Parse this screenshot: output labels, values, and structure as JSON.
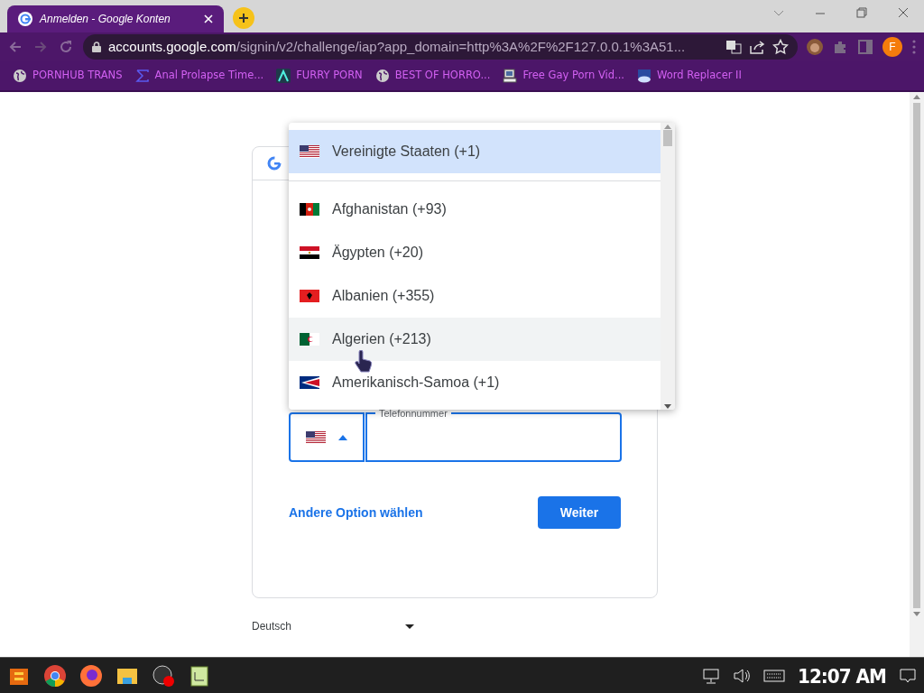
{
  "browser": {
    "tab": {
      "title": "Anmelden - Google Konten",
      "selected": true
    },
    "url": {
      "host": "accounts.google.com",
      "path": "/signin/v2/challenge/iap?app_domain=http%3A%2F%2F127.0.0.1%3A51..."
    },
    "profile_initial": "F",
    "bookmarks": [
      {
        "label": "PORNHUB TRANS",
        "kind": "globe"
      },
      {
        "label": "Anal Prolapse Time...",
        "kind": "sigma"
      },
      {
        "label": "FURRY PORN",
        "kind": "lambda"
      },
      {
        "label": "BEST OF HORRO...",
        "kind": "globe"
      },
      {
        "label": "Free Gay Porn Vid...",
        "kind": "computer"
      },
      {
        "label": "Word Replacer II",
        "kind": "cloud"
      }
    ]
  },
  "card": {
    "phone_label": "Telefonnummer",
    "other_option_link": "Andere Option wählen",
    "next_button": "Weiter"
  },
  "country_dropdown": {
    "items": [
      {
        "label": "Vereinigte Staaten (+1)",
        "kind": "us",
        "selected": true,
        "hovered": false
      },
      {
        "label": "Afghanistan (+93)",
        "kind": "af",
        "selected": false,
        "hovered": false
      },
      {
        "label": "Ägypten (+20)",
        "kind": "eg",
        "selected": false,
        "hovered": false
      },
      {
        "label": "Albanien (+355)",
        "kind": "al",
        "selected": false,
        "hovered": false
      },
      {
        "label": "Algerien (+213)",
        "kind": "dz",
        "selected": false,
        "hovered": true
      },
      {
        "label": "Amerikanisch-Samoa (+1)",
        "kind": "as",
        "selected": false,
        "hovered": false
      }
    ]
  },
  "language": "Deutsch",
  "taskbar": {
    "clock": "12:07 AM"
  }
}
